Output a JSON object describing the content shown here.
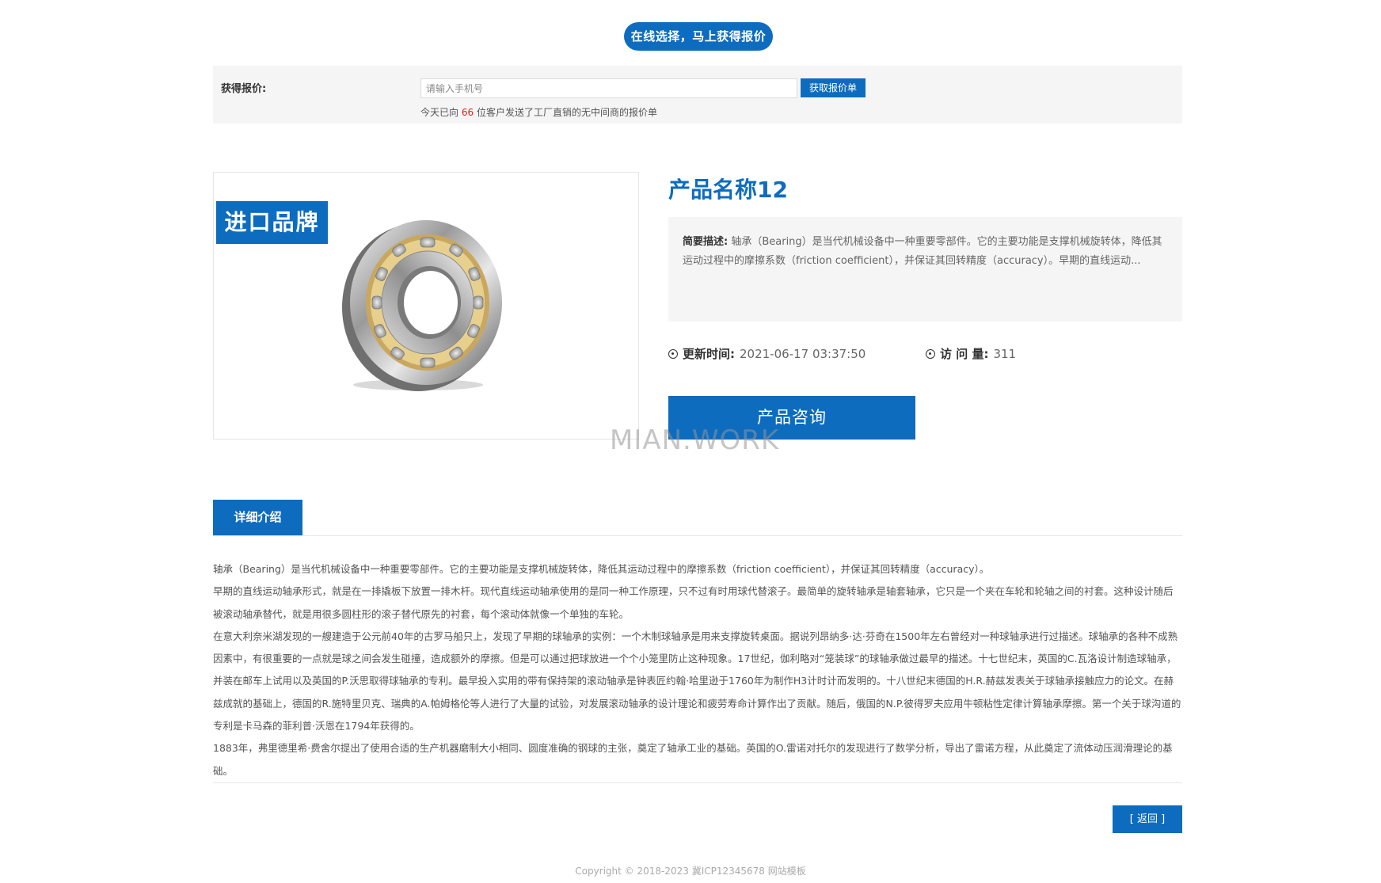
{
  "banner": {
    "text": "在线选择，马上获得报价"
  },
  "quote": {
    "label": "获得报价:",
    "placeholder": "请输入手机号",
    "button": "获取报价单",
    "note_before": "今天已向",
    "count": "66",
    "note_after": "位客户发送了工厂直销的无中间商的报价单"
  },
  "product": {
    "brand_tag": "进口品牌",
    "title": "产品名称12",
    "desc_label": "简要描述:",
    "desc_text": "轴承（Bearing）是当代机械设备中一种重要零部件。它的主要功能是支撑机械旋转体，降低其运动过程中的摩擦系数（friction coefficient），并保证其回转精度（accuracy）。早期的直线运动...",
    "update_label": "更新时间:",
    "update_value": "2021-06-17 03:37:50",
    "visits_label": "访 问 量:",
    "visits_value": "311",
    "consult_button": "产品咨询"
  },
  "watermark": "MIAN.WORK",
  "details": {
    "tab": "详细介绍",
    "paragraphs": [
      "轴承（Bearing）是当代机械设备中一种重要零部件。它的主要功能是支撑机械旋转体，降低其运动过程中的摩擦系数（friction coefficient），并保证其回转精度（accuracy）。",
      "早期的直线运动轴承形式，就是在一排撬板下放置一排木杆。现代直线运动轴承使用的是同一种工作原理，只不过有时用球代替滚子。最简单的旋转轴承是轴套轴承，它只是一个夹在车轮和轮轴之间的衬套。这种设计随后被滚动轴承替代，就是用很多圆柱形的滚子替代原先的衬套，每个滚动体就像一个单独的车轮。",
      "在意大利奈米湖发现的一艘建造于公元前40年的古罗马船只上，发现了早期的球轴承的实例：一个木制球轴承是用来支撑旋转桌面。据说列昂纳多·达·芬奇在1500年左右曾经对一种球轴承进行过描述。球轴承的各种不成熟因素中，有很重要的一点就是球之间会发生碰撞，造成额外的摩擦。但是可以通过把球放进一个个小笼里防止这种现象。17世纪，伽利略对“笼装球”的球轴承做过最早的描述。十七世纪末，英国的C.瓦洛设计制造球轴承，并装在邮车上试用以及英国的P.沃思取得球轴承的专利。最早投入实用的带有保持架的滚动轴承是钟表匠约翰·哈里逊于1760年为制作H3计时计而发明的。十八世纪末德国的H.R.赫兹发表关于球轴承接触应力的论文。在赫兹成就的基础上，德国的R.施特里贝克、瑞典的A.帕姆格伦等人进行了大量的试验，对发展滚动轴承的设计理论和疲劳寿命计算作出了贡献。随后，俄国的N.P.彼得罗夫应用牛顿粘性定律计算轴承摩擦。第一个关于球沟道的专利是卡马森的菲利普·沃恩在1794年获得的。",
      "1883年，弗里德里希·费舍尔提出了使用合适的生产机器磨制大小相同、圆度准确的钢球的主张，奠定了轴承工业的基础。英国的O.雷诺对托尔的发现进行了数学分析，导出了雷诺方程，从此奠定了流体动压润滑理论的基础。"
    ]
  },
  "back_button": "[ 返回 ]",
  "footer": "Copyright © 2018-2023 冀ICP12345678 网站模板",
  "colors": {
    "accent": "#0e6cbf",
    "count_red": "#e02020",
    "panel": "#f5f5f5"
  }
}
